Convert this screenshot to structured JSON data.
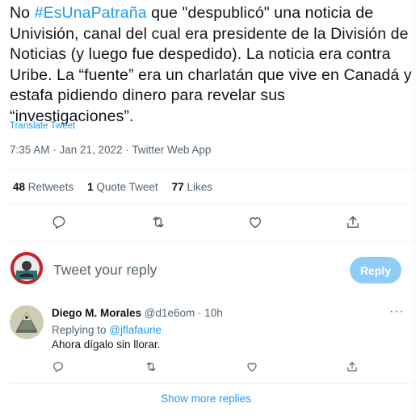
{
  "tweet": {
    "text_prefix": "No ",
    "hashtag": "#EsUnaPatraña",
    "text_rest": " que \"despublicó\" una noticia de Univisión, canal del cual era presidente de la División de Noticias (y luego fue despedido). La noticia era contra Uribe. La “fuente” era un charlatán que vive en Canadá y estafa pidiendo dinero para revelar sus “investigaciones”.",
    "translate_label": "Translate Tweet",
    "timestamp": "7:35 AM · Jan 21, 2022 · Twitter Web App"
  },
  "stats": {
    "retweets_count": "48",
    "retweets_label": "Retweets",
    "quotes_count": "1",
    "quotes_label": "Quote Tweet",
    "likes_count": "77",
    "likes_label": "Likes"
  },
  "actions": {
    "icons": [
      "reply-icon",
      "retweet-icon",
      "like-icon",
      "share-icon"
    ]
  },
  "composer": {
    "placeholder": "Tweet your reply",
    "reply_button": "Reply"
  },
  "reply": {
    "name": "Diego M. Morales",
    "handle": "@d1e6om · 10h",
    "replying_prefix": "Replying to ",
    "replying_to": "@jflafaurie",
    "text": "Ahora dígalo sin llorar.",
    "more_icon": "more-dots-icon"
  },
  "footer": {
    "show_more": "Show more replies"
  },
  "colors": {
    "accent": "#1d9bf0",
    "muted": "#536471",
    "text": "#0f1419",
    "reply_button_disabled": "#8ecdf8"
  }
}
